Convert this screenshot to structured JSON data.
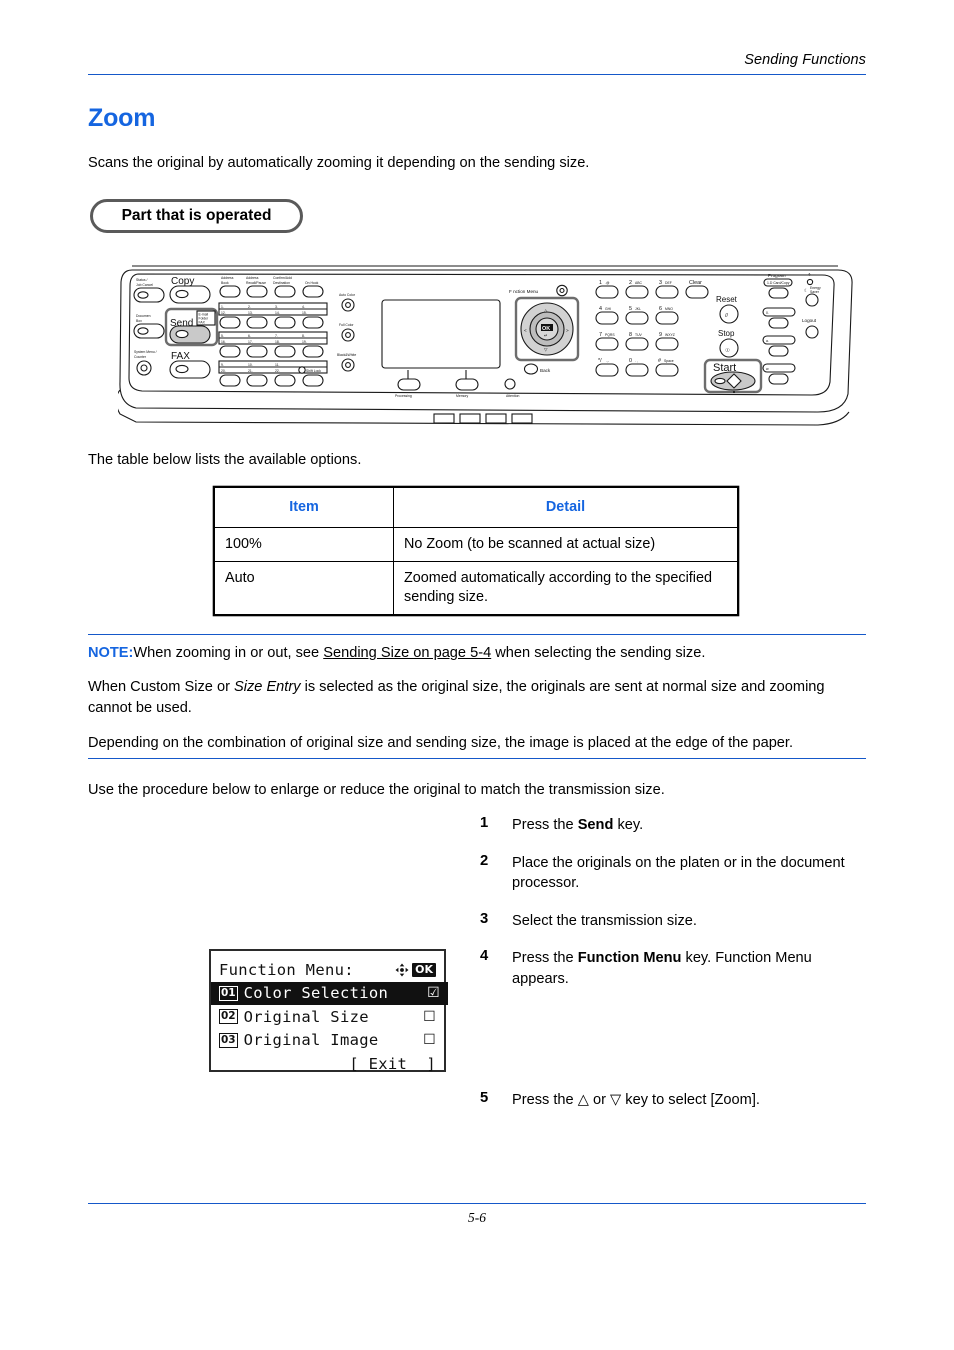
{
  "header": {
    "running_head": "Sending Functions",
    "page_number": "5-6"
  },
  "section": {
    "title": "Zoom",
    "intro": "Scans the original by automatically zooming it depending on the sending size.",
    "callout_label": "Part that is operated",
    "table_lead": "The table below lists the available options.",
    "procedure_lead": "Use the procedure below to enlarge or reduce the original to match the transmission size."
  },
  "options_table": {
    "headers": [
      "Item",
      "Detail"
    ],
    "rows": [
      {
        "item": "100%",
        "detail": "No Zoom (to be scanned at actual size)"
      },
      {
        "item": "Auto",
        "detail": "Zoomed automatically according to the specified sending size."
      }
    ]
  },
  "note": {
    "label": "NOTE:",
    "line1_before": "When zooming in or out, see ",
    "line1_link": "Sending Size on page 5-4",
    "line1_after": " when selecting the sending size.",
    "para2_a": "When Custom Size or ",
    "para2_italic": "Size Entry",
    "para2_b": " is selected as the original size, the originals are sent at normal size and zooming cannot be used.",
    "para3": "Depending on the combination of original size and sending size, the image is placed at the edge of the paper."
  },
  "steps": [
    {
      "num": "1",
      "pre": "Press the ",
      "bold": "Send",
      "post": " key."
    },
    {
      "num": "2",
      "pre": "Place the originals on the platen or in the document processor.",
      "bold": "",
      "post": ""
    },
    {
      "num": "3",
      "pre": "Select the transmission size.",
      "bold": "",
      "post": ""
    },
    {
      "num": "4",
      "pre": "Press the ",
      "bold": "Function Menu",
      "post": " key. Function Menu appears."
    },
    {
      "num": "5",
      "pre": "Press the △ or ▽ key to select [Zoom].",
      "bold": "",
      "post": ""
    }
  ],
  "lcd": {
    "title": "Function Menu:",
    "header_icons": [
      "four-way-arrow-icon",
      "ok-badge"
    ],
    "ok_label": "OK",
    "items": [
      {
        "num": "01",
        "label": "Color Selection",
        "mark": "checked",
        "selected": true
      },
      {
        "num": "02",
        "label": "Original Size",
        "mark": "unchecked",
        "selected": false
      },
      {
        "num": "03",
        "label": "Original Image",
        "mark": "unchecked",
        "selected": false
      }
    ],
    "exit_label": "[ Exit  ]"
  },
  "control_panel": {
    "left_keys": [
      {
        "label": "Status /\nJob Cancel"
      },
      {
        "label": "Document\nBox"
      },
      {
        "label": "System Menu /\nCounter"
      }
    ],
    "mode_keys": [
      "Copy",
      "Send",
      "FAX"
    ],
    "send_sub_label": "E-mail\nFolder\nFAX",
    "send_highlighted": true,
    "top_keys": [
      "Address Book",
      "Address Recall/Pause",
      "Confirm/Add Destination",
      "On Hook"
    ],
    "color_keys": [
      "Auto Color",
      "Full Color",
      "Black&White"
    ],
    "status_labels": [
      "Processing",
      "Memory",
      "Attention"
    ],
    "function_menu_label": "Function Menu",
    "function_menu_highlighted": true,
    "back_label": "Back",
    "ok_label": "OK",
    "keypad": [
      [
        "1.@",
        "2 ABC",
        "3 DEF",
        "Clear"
      ],
      [
        "4 GHI",
        "5 JKL",
        "6 MNO",
        ""
      ],
      [
        "7 PQRS",
        "8 TUV",
        "9 WXYZ",
        ""
      ],
      [
        "*/.,-",
        "0 . ,",
        "# Space",
        ""
      ]
    ],
    "right_keys": [
      "Reset",
      "Stop",
      "Start",
      "Program",
      "Energy Saver",
      "Logout"
    ],
    "start_highlighted": true,
    "shift_lock_label": "Shift Lock",
    "one_touch_rows": [
      [
        "1.",
        "2.",
        "3.",
        "4."
      ],
      [
        "12.",
        "13.",
        "14.",
        "15."
      ],
      [
        "5.",
        "6.",
        "7.",
        "8."
      ],
      [
        "16.",
        "17.",
        "18.",
        "19."
      ],
      [
        "9.",
        "10.",
        "11.",
        ""
      ],
      [
        "20.",
        "21.",
        "22.",
        ""
      ]
    ]
  },
  "colors": {
    "accent_blue": "#1565e0",
    "rule_blue": "#1558c9",
    "pill_border": "#5a5a5a",
    "highlight_gray": "#c9c9c9"
  }
}
